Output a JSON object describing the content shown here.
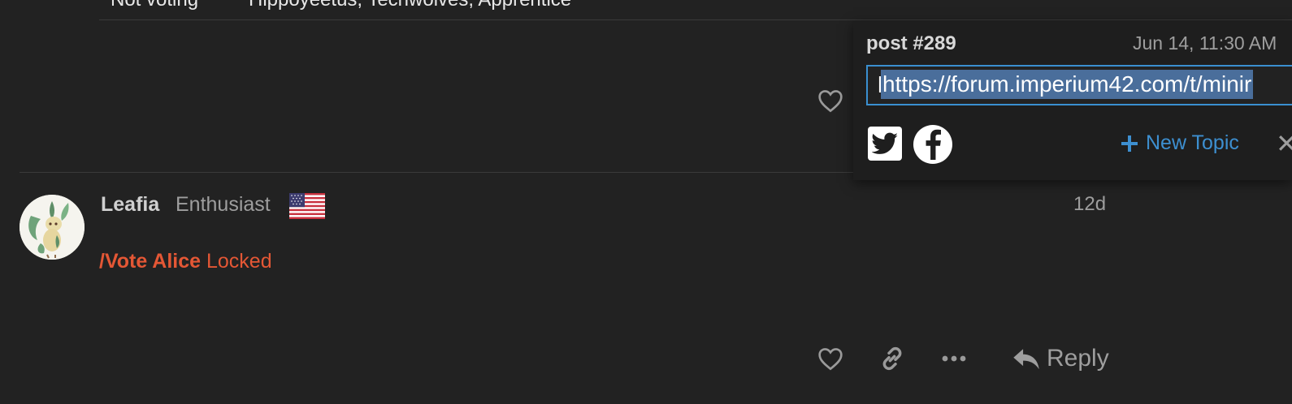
{
  "table": {
    "row_label": "Not voting",
    "row_value": "Hippoyeetus, Techwolves, Apprentice"
  },
  "post": {
    "username": "Leafia",
    "user_title": "Enthusiast",
    "age": "12d",
    "body_vote": "/Vote Alice",
    "body_rest": " Locked"
  },
  "actions": {
    "reply_label": "Reply"
  },
  "share": {
    "title": "post #289",
    "date": "Jun 14, 11:30 AM",
    "url": "https://forum.imperium42.com/t/minir",
    "new_topic_label": "New Topic",
    "close_glyph": "✕"
  },
  "colors": {
    "background": "#222222",
    "vote_red": "#e45735",
    "link_blue": "#3d8fd0",
    "selection": "#4a6e9b"
  }
}
